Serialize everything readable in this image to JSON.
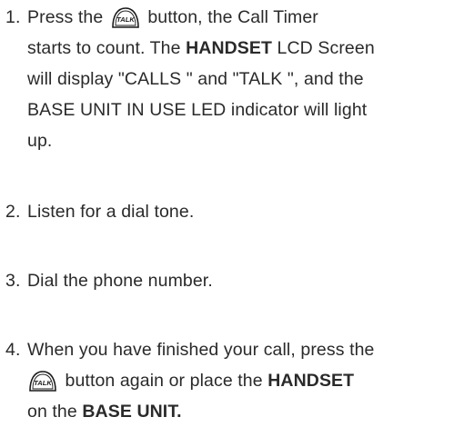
{
  "icons": {
    "talk_button": "talk-button-icon",
    "talk_button_text": "TALK"
  },
  "steps": [
    {
      "number": "1.",
      "part1": "Press the",
      "part2": "button,  the  Call Timer",
      "line2a": "starts to count. The ",
      "line2b": "HANDSET",
      "line2c": " LCD Screen",
      "line3": "will display \"CALLS \"  and  \"TALK \", and  the",
      "line4": "BASE  UNIT  IN USE LED indicator will light",
      "line5": "up."
    },
    {
      "number": "2.",
      "text": "Listen for a dial tone."
    },
    {
      "number": "3.",
      "text": "Dial the phone number."
    },
    {
      "number": "4.",
      "line1": "When you have finished your call, press the",
      "line2a": "button again or place the  ",
      "line2b": "HANDSET",
      "line3a": "on the ",
      "line3b": "BASE UNIT."
    }
  ]
}
